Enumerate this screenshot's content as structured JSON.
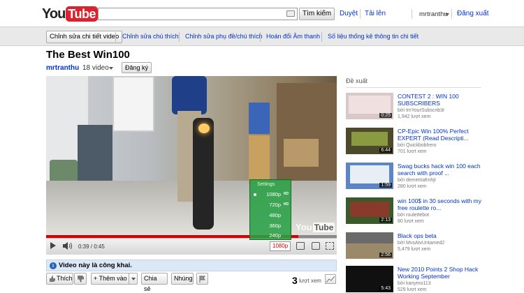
{
  "header": {
    "logo_you": "You",
    "logo_tube": "Tube",
    "search_placeholder": "",
    "search_button": "Tìm kiếm",
    "browse_link": "Duyệt",
    "upload_link": "Tải lên",
    "username": "mrtranthu",
    "signout_link": "Đăng xuất"
  },
  "owner_bar": {
    "edit_details": "Chỉnh sửa chi tiết video",
    "links": [
      "Chỉnh sửa chú thích",
      "Chỉnh sửa phụ đề/chú thích",
      "Hoán đổi Âm thanh",
      "Số liệu thống kê thông tin chi tiết"
    ]
  },
  "video": {
    "title": "The Best Win100",
    "channel": "mrtranthu",
    "video_count": "18 video",
    "subscribe": "Đăng ký",
    "time": "0:39 / 0:45",
    "progress_fraction": 0.867,
    "quality": "1080p",
    "watermark_you": "You",
    "watermark_tube": "Tube",
    "watermark_hd": "HD",
    "settings": {
      "title": "Settings",
      "options": [
        {
          "label": "1080p",
          "hd": "HD",
          "selected": true
        },
        {
          "label": "720p",
          "hd": "HD",
          "selected": false
        },
        {
          "label": "480p",
          "hd": "",
          "selected": false
        },
        {
          "label": "360p",
          "hd": "",
          "selected": false
        },
        {
          "label": "240p",
          "hd": "",
          "selected": false
        }
      ]
    }
  },
  "below": {
    "public_notice": "Video này là công khai.",
    "like": "Thích",
    "add_to": "+ Thêm vào",
    "share": "Chia sẻ",
    "embed": "Nhúng",
    "view_count": "3",
    "view_label": "lượt xem"
  },
  "sidebar": {
    "title": "Đề xuất",
    "items": [
      {
        "title": "CONTEST 2 : WIN 100 SUBSCRIBERS",
        "by": "bởi ImYourSubscrib3r",
        "views": "1,942 lượt xem",
        "duration": "0:25",
        "thumb_color": "#d8c8c8"
      },
      {
        "title": "CP-Epic Win 100% Perfect EXPERT (Read Descripti...",
        "by": "bởi Quickbobhero",
        "views": "701 lượt xem",
        "duration": "6:44",
        "thumb_color": "#4c4a2a"
      },
      {
        "title": "Swag bucks hack win 100 each search with proof ...",
        "by": "bởi demetriafrnhjt",
        "views": "280 lượt xem",
        "duration": "1:59",
        "thumb_color": "#5a86c8"
      },
      {
        "title": "win 100$ in 30 seconds with my free roulette ro...",
        "by": "bởi roulettebot",
        "views": "80 lượt xem",
        "duration": "2:13",
        "thumb_color": "#3a5a2a"
      },
      {
        "title": "Black ops beta",
        "by": "bởi MvsAtvUntamed2",
        "views": "5,479 lượt xem",
        "duration": "2:56",
        "thumb_color": "#6a6a6a"
      },
      {
        "title": "New 2010 Points 2 Shop Hack Working September",
        "by": "bởi kanymo113",
        "views": "529 lượt xem",
        "duration": "5:43",
        "thumb_color": "#101010"
      }
    ]
  }
}
